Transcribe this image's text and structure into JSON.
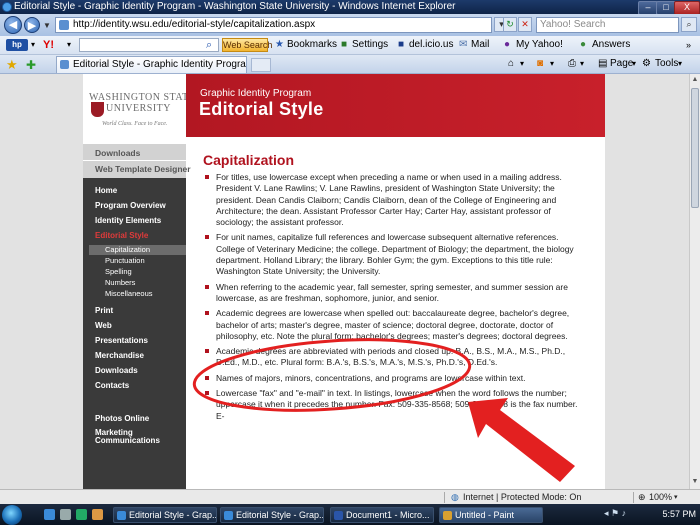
{
  "window": {
    "title": "Editorial Style - Graphic Identity Program - Washington State University - Windows Internet Explorer",
    "min": "–",
    "max": "□",
    "close": "X"
  },
  "addressbar": {
    "url": "http://identity.wsu.edu/editorial-style/capitalization.aspx",
    "search_placeholder": "Yahoo! Search"
  },
  "yahoo_toolbar": {
    "hp": "hp",
    "logo": "Y!",
    "web_search": "Web Search",
    "items": [
      "Bookmarks",
      "Settings",
      "del.icio.us",
      "Mail",
      "My Yahoo!",
      "Answers"
    ]
  },
  "tabs": {
    "active": "Editorial Style - Graphic Identity Program - Washi...",
    "commands": [
      "Page",
      "Tools"
    ]
  },
  "site": {
    "logo_line1": "WASHINGTON STATE",
    "logo_line2": "UNIVERSITY",
    "tagline": "World Class. Face to Face.",
    "banner_sub": "Graphic Identity Program",
    "banner_title": "Editorial Style",
    "top_links": [
      "Downloads",
      "Web Template Designer"
    ],
    "nav": [
      {
        "label": "Home",
        "active": false
      },
      {
        "label": "Program Overview",
        "active": false
      },
      {
        "label": "Identity Elements",
        "active": false
      },
      {
        "label": "Editorial Style",
        "active": true
      },
      {
        "label": "Print",
        "active": false
      },
      {
        "label": "Web",
        "active": false
      },
      {
        "label": "Presentations",
        "active": false
      },
      {
        "label": "Merchandise",
        "active": false
      },
      {
        "label": "Downloads",
        "active": false
      },
      {
        "label": "Contacts",
        "active": false
      },
      {
        "label": "Photos Online",
        "active": false
      },
      {
        "label": "Marketing Communications",
        "active": false
      }
    ],
    "subnav": [
      {
        "label": "Capitalization",
        "active": true
      },
      {
        "label": "Punctuation",
        "active": false
      },
      {
        "label": "Spelling",
        "active": false
      },
      {
        "label": "Numbers",
        "active": false
      },
      {
        "label": "Miscellaneous",
        "active": false
      }
    ]
  },
  "content": {
    "heading": "Capitalization",
    "bullets": [
      "For titles, use lowercase except when preceding a name or when used in a mailing address. President V. Lane Rawlins; V. Lane Rawlins, president of Washington State University; the president. Dean Candis Claiborn; Candis Claiborn, dean of the College of Engineering and Architecture; the dean. Assistant Professor Carter Hay; Carter Hay, assistant professor of sociology; the assistant professor.",
      "For unit names, capitalize full references and lowercase subsequent alternative references. College of Veterinary Medicine; the college. Department of Biology; the department, the biology department. Holland Library; the library. Bohler Gym; the gym. Exceptions to this title rule: Washington State University; the University.",
      "When referring to the academic year, fall semester, spring semester, and summer session are lowercase, as are freshman, sophomore, junior, and senior.",
      "Academic degrees are lowercase when spelled out: baccalaureate degree, bachelor's degree, bachelor of arts; master's degree, master of science; doctoral degree, doctorate, doctor of philosophy, etc. Note the plural form: bachelor's degrees; master's degrees; doctoral degrees.",
      "Academic degrees are abbreviated with periods and closed up: B.A., B.S., M.A., M.S., Ph.D., D.Ed., M.D., etc. Plural form: B.A.'s, B.S.'s, M.A.'s, M.S.'s, Ph.D.'s, D.Ed.'s.",
      "Names of majors, minors, concentrations, and programs are lowercase within text.",
      "Lowercase \"fax\" and \"e-mail\" in text. In listings, lowercase when the word follows the number; uppercase it when it precedes the number. Fax: 509-335-8568; 509-335-8568 is the fax number. E-"
    ]
  },
  "statusbar": {
    "zone": "Internet | Protected Mode: On",
    "zoom": "100%"
  },
  "taskbar": {
    "buttons": [
      "Editorial Style - Grap...",
      "Editorial Style - Grap...",
      "Document1 - Micro...",
      "Untitled - Paint"
    ],
    "time": "5:57 PM"
  },
  "colors": {
    "banner_red": "#c8202b",
    "heading_red": "#b0121e",
    "annotation_red": "#e32020",
    "nav_dark": "#3a3a3a"
  }
}
